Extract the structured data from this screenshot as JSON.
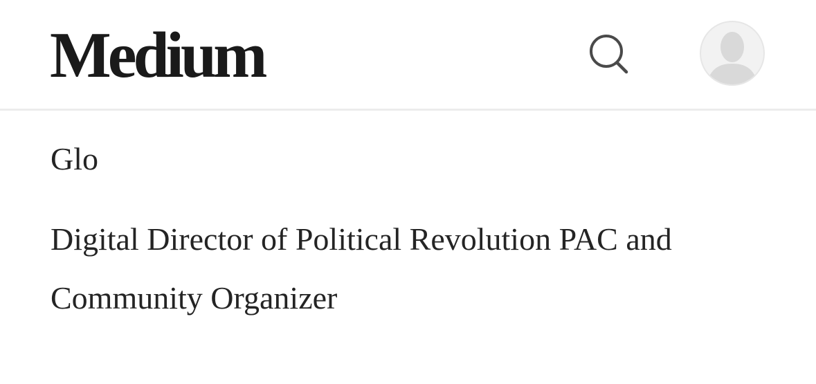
{
  "header": {
    "logo_text": "Medium",
    "search_icon": "search-icon",
    "avatar_icon": "user-avatar-icon"
  },
  "profile": {
    "name": "Glo",
    "bio": "Digital Director of Political Revolution PAC and Community Organizer"
  },
  "colors": {
    "text": "#242424",
    "divider": "#ececec",
    "avatar_bg": "#f2f2f2",
    "avatar_silhouette": "#d9d9d9"
  }
}
